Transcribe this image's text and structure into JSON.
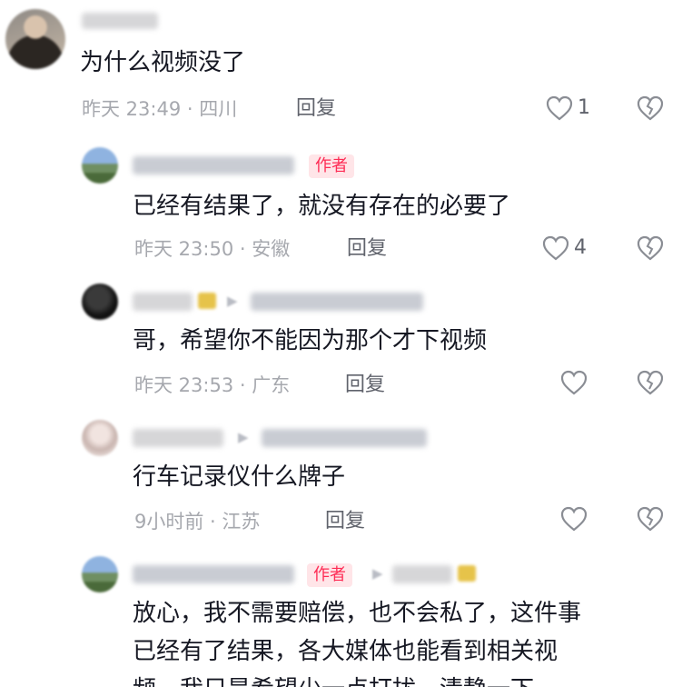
{
  "comments": [
    {
      "text": "为什么视频没了",
      "meta": "昨天 23:49 · 四川",
      "reply": "回复",
      "likes": "1"
    },
    {
      "badge": "作者",
      "text": "已经有结果了，就没有存在的必要了",
      "meta": "昨天 23:50 · 安徽",
      "reply": "回复",
      "likes": "4"
    },
    {
      "text": "哥，希望你不能因为那个才下视频",
      "meta": "昨天 23:53 · 广东",
      "reply": "回复"
    },
    {
      "text": "行车记录仪什么牌子",
      "meta": "9小时前 · 江苏",
      "reply": "回复"
    },
    {
      "badge": "作者",
      "lines": [
        "放心，我不需要赔偿，也不会私了，这件事",
        "已经有了结果，各大媒体也能看到相关视",
        "频，我只是希望少一点打扰，清静一下"
      ]
    }
  ],
  "icons": {
    "like": "heart-outline-icon",
    "dislike": "broken-heart-icon",
    "reply_arrow": "triangle-right-icon"
  },
  "colors": {
    "author_badge_text": "#fe2c55",
    "author_badge_bg": "#ffe5e8",
    "meta": "#a6a8ae"
  }
}
